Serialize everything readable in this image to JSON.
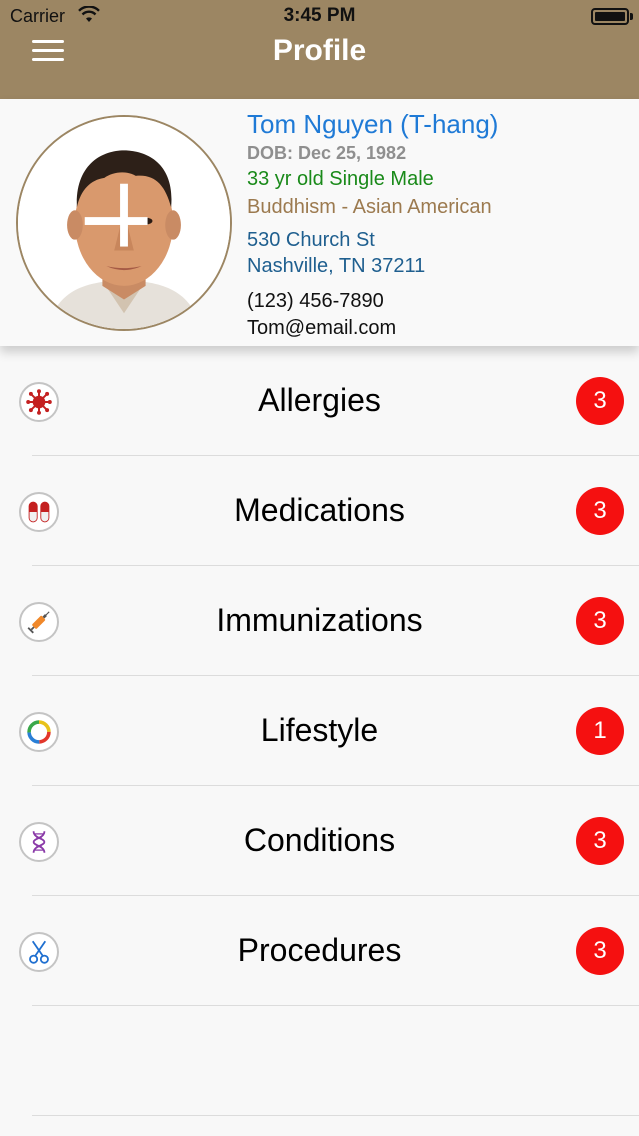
{
  "status_bar": {
    "carrier": "Carrier",
    "time": "3:45 PM"
  },
  "nav": {
    "title": "Profile",
    "menu_icon": "hamburger-menu-icon"
  },
  "profile": {
    "name": "Tom Nguyen (T-hang)",
    "dob": "DOB: Dec 25, 1982",
    "age_status": "33 yr old Single Male",
    "religion_ethnicity": "Buddhism - Asian American",
    "address_line1": "530 Church St",
    "address_line2": "Nashville, TN 37211",
    "phone": "(123) 456-7890",
    "email": "Tom@email.com",
    "colors": {
      "name": "#1f7ad6",
      "age": "#1a8a1a",
      "religion": "#9c7a4f",
      "address": "#1f5f8f"
    }
  },
  "sections": [
    {
      "label": "Allergies",
      "count": "3",
      "icon": "allergen-icon"
    },
    {
      "label": "Medications",
      "count": "3",
      "icon": "pill-capsule-icon"
    },
    {
      "label": "Immunizations",
      "count": "3",
      "icon": "syringe-icon"
    },
    {
      "label": "Lifestyle",
      "count": "1",
      "icon": "ring-chart-icon"
    },
    {
      "label": "Conditions",
      "count": "3",
      "icon": "dna-icon"
    },
    {
      "label": "Procedures",
      "count": "3",
      "icon": "scissors-icon"
    }
  ],
  "theme": {
    "header_bg": "#9c8663",
    "badge_bg": "#f51010"
  }
}
